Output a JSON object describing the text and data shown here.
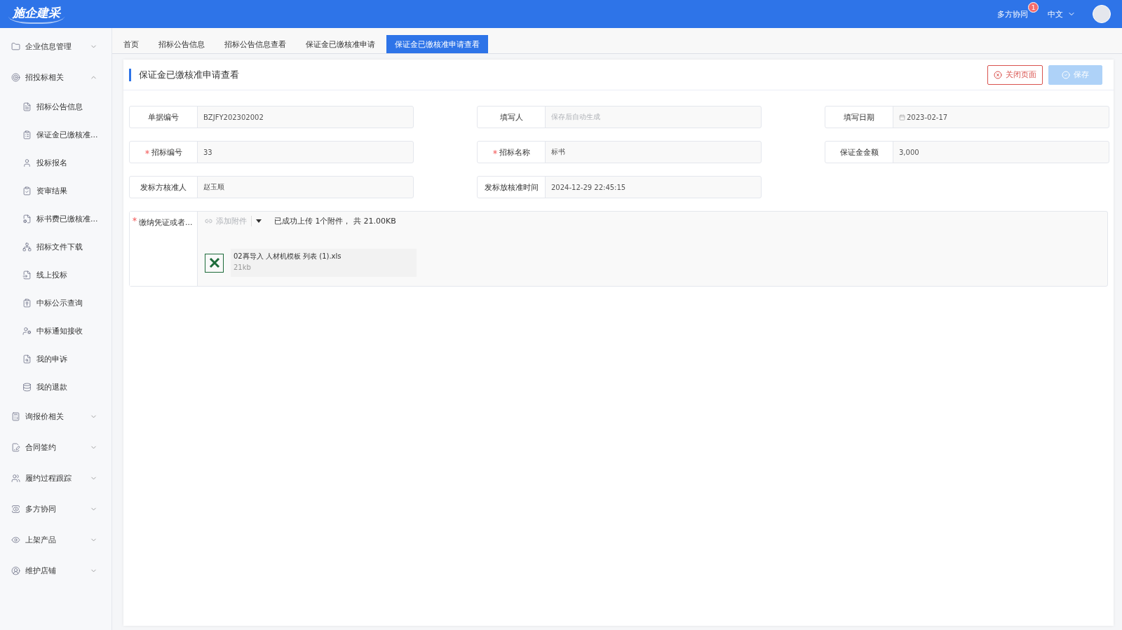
{
  "header": {
    "logo": "施企建采",
    "collab": {
      "label": "多方协同",
      "badge": "1"
    },
    "language": "中文"
  },
  "sidebar": {
    "items": [
      {
        "label": "企业信息管理",
        "expanded": false
      },
      {
        "label": "招投标相关",
        "expanded": true,
        "children": [
          {
            "label": "招标公告信息"
          },
          {
            "label": "保证金已缴核准..."
          },
          {
            "label": "投标报名"
          },
          {
            "label": "资审结果"
          },
          {
            "label": "标书费已缴核准..."
          },
          {
            "label": "招标文件下载"
          },
          {
            "label": "线上投标"
          },
          {
            "label": "中标公示查询"
          },
          {
            "label": "中标通知接收"
          },
          {
            "label": "我的申诉"
          },
          {
            "label": "我的退款"
          }
        ]
      },
      {
        "label": "询报价相关",
        "expanded": false
      },
      {
        "label": "合同签约",
        "expanded": false
      },
      {
        "label": "履约过程跟踪",
        "expanded": false
      },
      {
        "label": "多方协同",
        "expanded": false
      },
      {
        "label": "上架产品",
        "expanded": false
      },
      {
        "label": "维护店铺",
        "expanded": false
      }
    ]
  },
  "tabs": [
    {
      "label": "首页",
      "selected": false
    },
    {
      "label": "招标公告信息",
      "selected": false
    },
    {
      "label": "招标公告信息查看",
      "selected": false
    },
    {
      "label": "保证金已缴核准申请",
      "selected": false
    },
    {
      "label": "保证金已缴核准申请查看",
      "selected": true
    }
  ],
  "page": {
    "title": "保证金已缴核准申请查看",
    "buttons": [
      {
        "kind": "close",
        "label": "关闭页面",
        "disabled": false
      },
      {
        "kind": "save",
        "label": "保存",
        "disabled": true
      }
    ],
    "fields": [
      {
        "kind": "text",
        "label": "单据编号",
        "required": false,
        "value": "BZJFY202302002"
      },
      {
        "kind": "text",
        "label": "填写人",
        "required": false,
        "placeholder": "保存后自动生成"
      },
      {
        "kind": "date",
        "label": "填写日期",
        "required": false,
        "value": "2023-02-17"
      },
      {
        "kind": "text",
        "label": "招标编号",
        "required": true,
        "value": "33"
      },
      {
        "kind": "text",
        "label": "招标名称",
        "required": true,
        "value": "标书"
      },
      {
        "kind": "text",
        "label": "保证金金额",
        "required": false,
        "value": "3,000"
      },
      {
        "kind": "text",
        "label": "发标方核准人",
        "required": false,
        "value": "赵玉顺"
      },
      {
        "kind": "text",
        "label": "发标放核准时间",
        "required": false,
        "value": "2024-12-29 22:45:15"
      }
    ],
    "attachment": {
      "label": "缴纳凭证或者...",
      "required": true,
      "add_label": "添加附件",
      "summary": "已成功上传 1个附件， 共 21.00KB",
      "files": [
        {
          "name": "02再导入 人材机模板 列表 (1).xls",
          "size": "21kb"
        }
      ]
    }
  }
}
